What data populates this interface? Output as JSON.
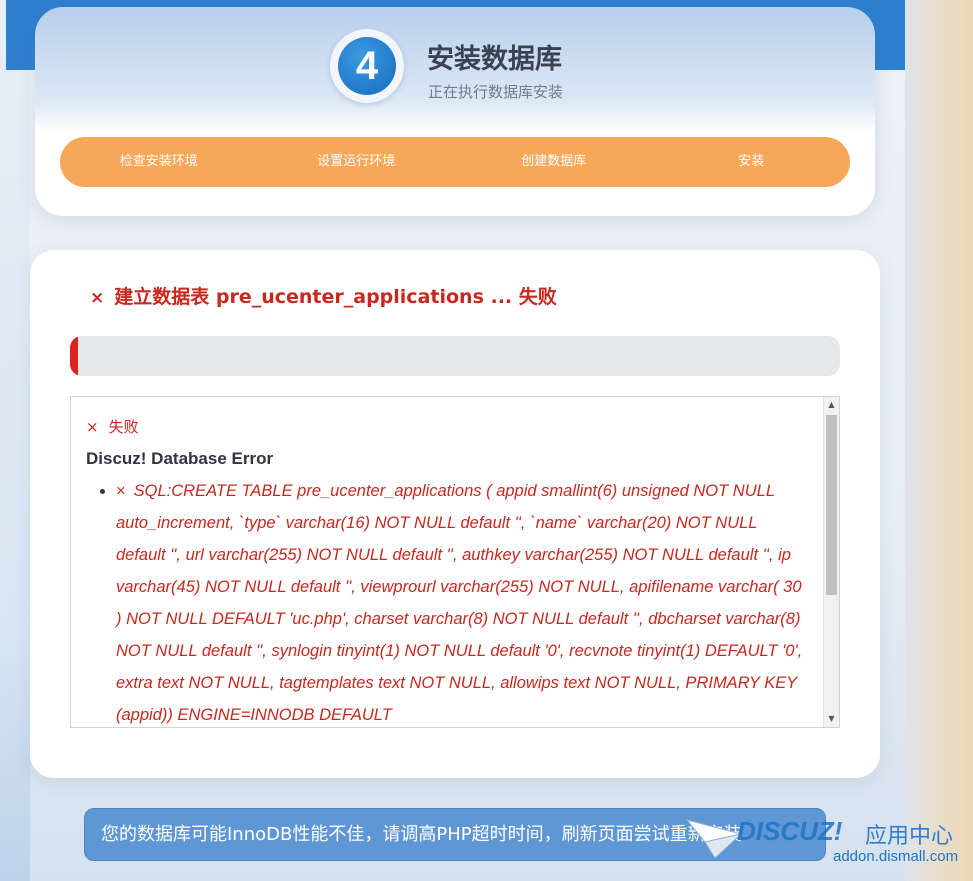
{
  "step": {
    "number": "4",
    "title": "安装数据库",
    "subtitle": "正在执行数据库安装"
  },
  "progress_steps": [
    "检查安装环境",
    "设置运行环境",
    "创建数据库",
    "安装"
  ],
  "status": {
    "icon": "×",
    "heading": "建立数据表 pre_ucenter_applications ... 失败",
    "progress_percent": 1
  },
  "log": {
    "fail_icon": "×",
    "fail_text": "失败",
    "error_title": "Discuz! Database Error",
    "item_icon": "×",
    "sql": "SQL:CREATE TABLE pre_ucenter_applications ( appid smallint(6) unsigned NOT NULL auto_increment, `type` varchar(16) NOT NULL default '', `name` varchar(20) NOT NULL default '', url varchar(255) NOT NULL default '', authkey varchar(255) NOT NULL default '', ip varchar(45) NOT NULL default '', viewprourl varchar(255) NOT NULL, apifilename varchar( 30 ) NOT NULL DEFAULT 'uc.php', charset varchar(8) NOT NULL default '', dbcharset varchar(8) NOT NULL default '', synlogin tinyint(1) NOT NULL default '0', recvnote tinyint(1) DEFAULT '0', extra text NOT NULL, tagtemplates text NOT NULL, allowips text NOT NULL, PRIMARY KEY (appid)) ENGINE=INNODB DEFAULT"
  },
  "notice": "您的数据库可能InnoDB性能不佳，请调高PHP超时时间，刷新页面尝试重新安装",
  "watermark": {
    "brand": "DISCUZ!",
    "label": "应用中心",
    "url": "addon.dismall.com"
  },
  "colors": {
    "header_blue": "#2f7fd1",
    "step_orange": "#f6a75a",
    "error_red": "#c8281e",
    "notice_blue": "#5f96d4"
  }
}
